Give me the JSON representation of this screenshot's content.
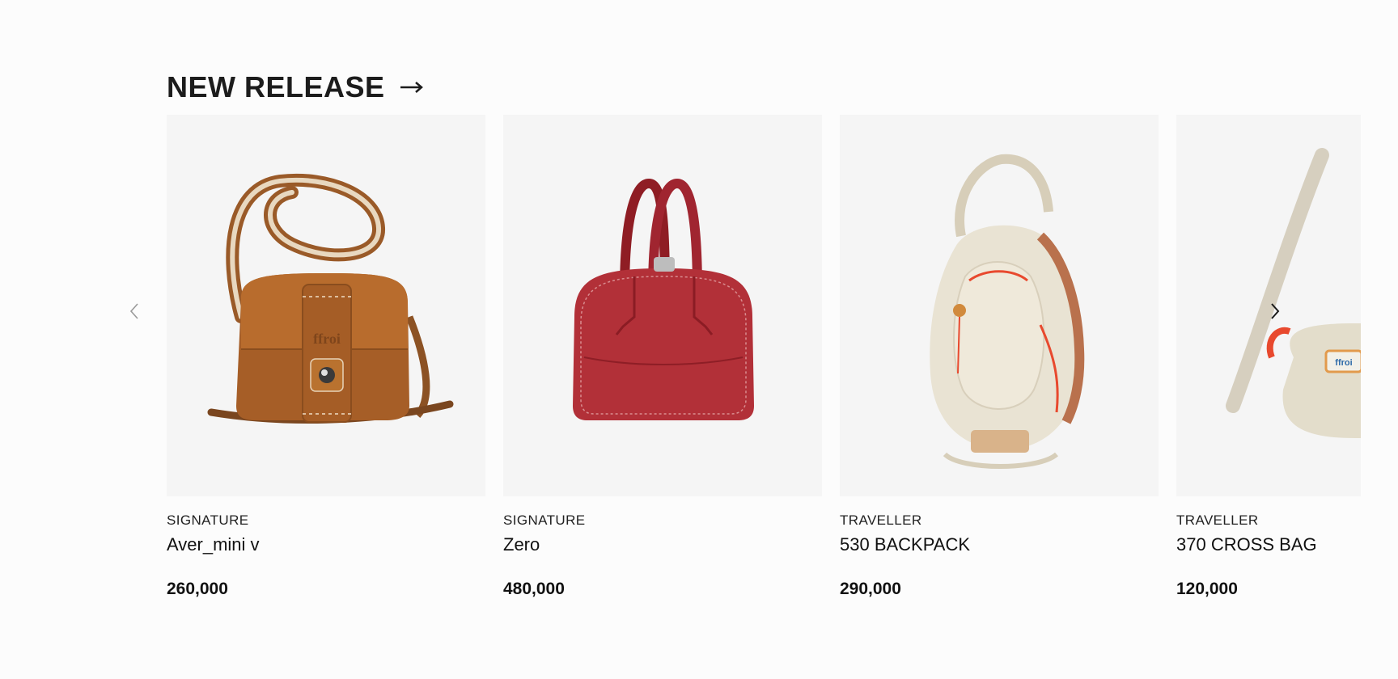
{
  "section": {
    "title": "NEW RELEASE",
    "title_icon": "arrow-right-icon"
  },
  "carousel": {
    "prev_icon": "chevron-left-icon",
    "next_icon": "chevron-right-icon",
    "products": [
      {
        "category": "SIGNATURE",
        "name": "Aver_mini v",
        "price": "260,000",
        "image": "brown-leather-crossbody-bag"
      },
      {
        "category": "SIGNATURE",
        "name": "Zero",
        "price": "480,000",
        "image": "red-leather-bowling-bag"
      },
      {
        "category": "TRAVELLER",
        "name": "530 BACKPACK",
        "price": "290,000",
        "image": "beige-nylon-backpack"
      },
      {
        "category": "TRAVELLER",
        "name": "370 CROSS BAG",
        "price": "120,000",
        "image": "beige-nylon-cross-bag"
      }
    ]
  },
  "colors": {
    "background": "#fcfcfc",
    "card_background": "#f5f5f5",
    "text": "#111111"
  }
}
